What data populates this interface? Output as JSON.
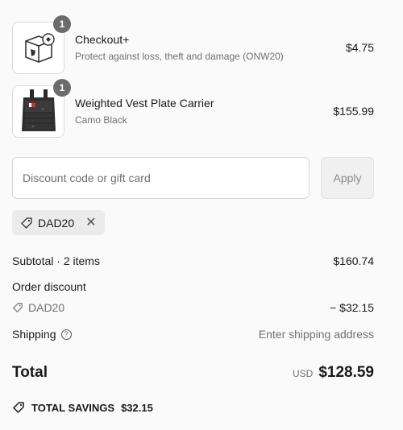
{
  "line_items": [
    {
      "quantity": "1",
      "name": "Checkout+",
      "subtitle": "Protect against loss, theft and damage (ONW20)",
      "price": "$4.75",
      "image": "box-shield-icon"
    },
    {
      "quantity": "1",
      "name": "Weighted Vest Plate Carrier",
      "subtitle": "Camo Black",
      "price": "$155.99",
      "image": "vest-product-image"
    }
  ],
  "discount": {
    "placeholder": "Discount code or gift card",
    "apply_label": "Apply",
    "applied_code": "DAD20"
  },
  "summary": {
    "subtotal_label": "Subtotal · 2 items",
    "subtotal_value": "$160.74",
    "order_discount_label": "Order discount",
    "discount_code": "DAD20",
    "discount_value": "− $32.15",
    "shipping_label": "Shipping",
    "shipping_value": "Enter shipping address",
    "total_label": "Total",
    "currency": "USD",
    "total_value": "$128.59",
    "savings_label": "TOTAL SAVINGS",
    "savings_value": "$32.15"
  }
}
